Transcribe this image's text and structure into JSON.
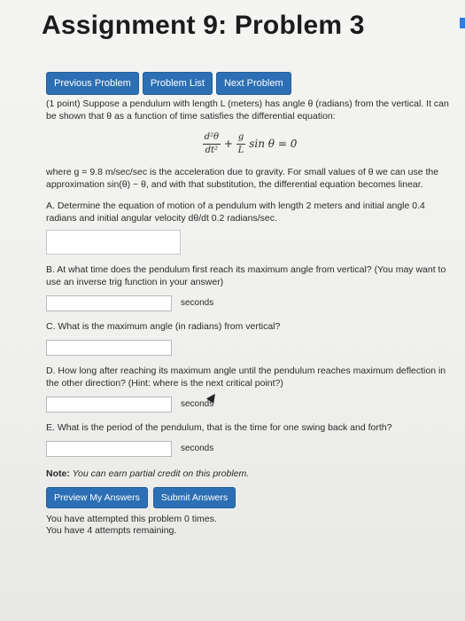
{
  "title": "Assignment 9: Problem 3",
  "nav": {
    "previous": "Previous Problem",
    "list": "Problem List",
    "next": "Next Problem"
  },
  "intro": "(1 point) Suppose a pendulum with length L (meters) has angle θ (radians) from the vertical. It can be shown that θ as a function of time satisfies the differential equation:",
  "equation": {
    "term1_num": "d²θ",
    "term1_den": "dt²",
    "plus": "+",
    "term2_num": "g",
    "term2_den": "L",
    "rest": "sin θ = 0"
  },
  "gravity_text": "where g = 9.8 m/sec/sec is the acceleration due to gravity. For small values of θ we can use the approximation sin(θ) ~ θ, and with that substitution, the differential equation becomes linear.",
  "questions": {
    "a": "A. Determine the equation of motion of a pendulum with length 2 meters and initial angle 0.4 radians and initial angular velocity dθ/dt 0.2 radians/sec.",
    "b": "B. At what time does the pendulum first reach its maximum angle from vertical? (You may want to use an inverse trig function in your answer)",
    "b_unit": "seconds",
    "c": "C. What is the maximum angle (in radians) from vertical?",
    "d": "D. How long after reaching its maximum angle until the pendulum reaches maximum deflection in the other direction? (Hint: where is the next critical point?)",
    "d_unit": "seconds",
    "e": "E. What is the period of the pendulum, that is the time for one swing back and forth?",
    "e_unit": "seconds"
  },
  "note_label": "Note:",
  "note_text": "You can earn partial credit on this problem.",
  "actions": {
    "preview": "Preview My Answers",
    "submit": "Submit Answers"
  },
  "status": {
    "attempted": "You have attempted this problem 0 times.",
    "remaining": "You have 4 attempts remaining."
  }
}
